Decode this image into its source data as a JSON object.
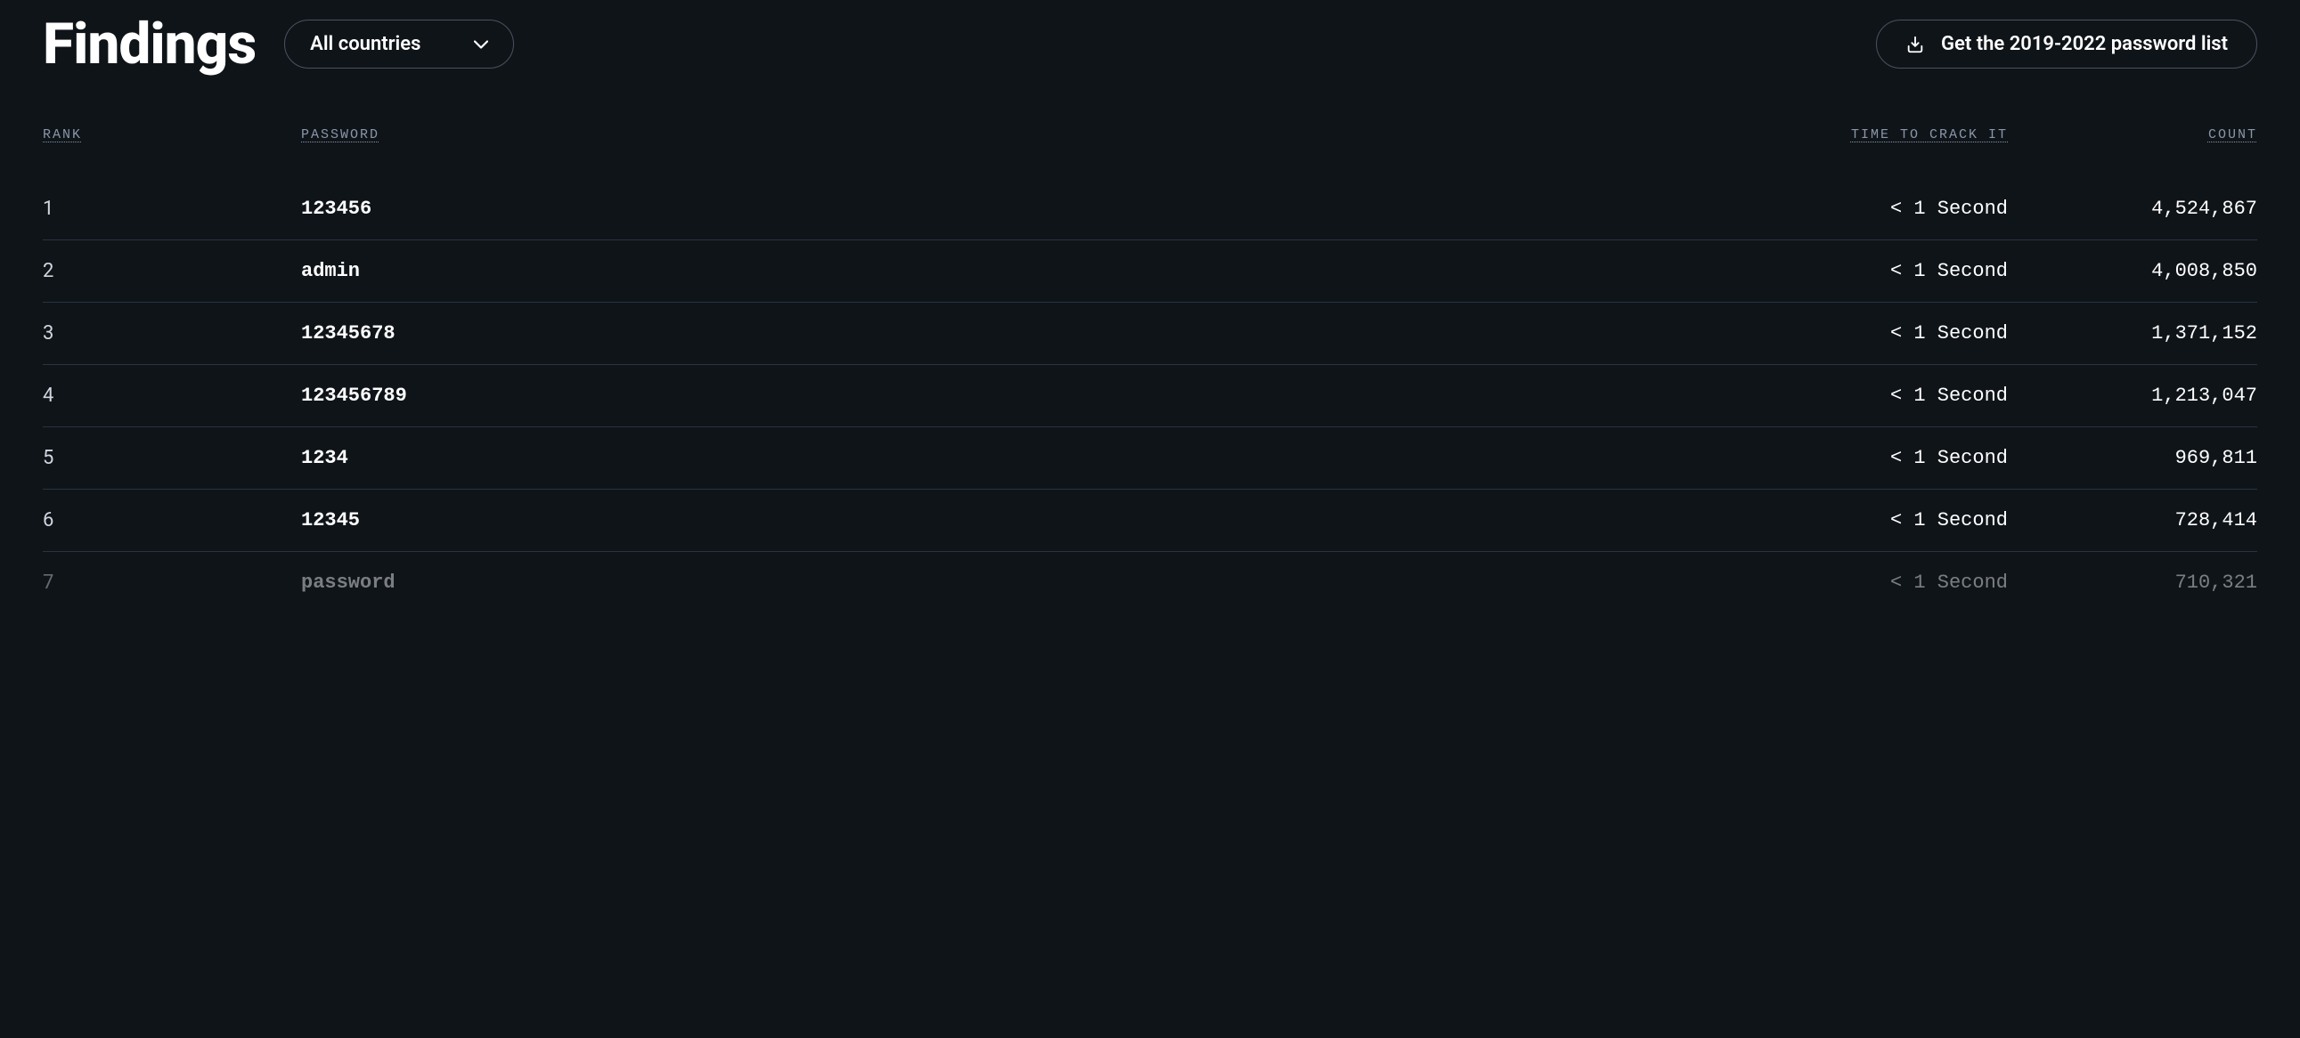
{
  "header": {
    "title": "Findings",
    "dropdown_label": "All countries",
    "download_label": "Get the 2019-2022 password list"
  },
  "columns": {
    "rank": "RANK",
    "password": "PASSWORD",
    "time": "TIME TO CRACK IT",
    "count": "COUNT"
  },
  "rows": [
    {
      "rank": "1",
      "password": "123456",
      "time": "< 1 Second",
      "count": "4,524,867"
    },
    {
      "rank": "2",
      "password": "admin",
      "time": "< 1 Second",
      "count": "4,008,850"
    },
    {
      "rank": "3",
      "password": "12345678",
      "time": "< 1 Second",
      "count": "1,371,152"
    },
    {
      "rank": "4",
      "password": "123456789",
      "time": "< 1 Second",
      "count": "1,213,047"
    },
    {
      "rank": "5",
      "password": "1234",
      "time": "< 1 Second",
      "count": "969,811"
    },
    {
      "rank": "6",
      "password": "12345",
      "time": "< 1 Second",
      "count": "728,414"
    },
    {
      "rank": "7",
      "password": "password",
      "time": "< 1 Second",
      "count": "710,321"
    }
  ]
}
